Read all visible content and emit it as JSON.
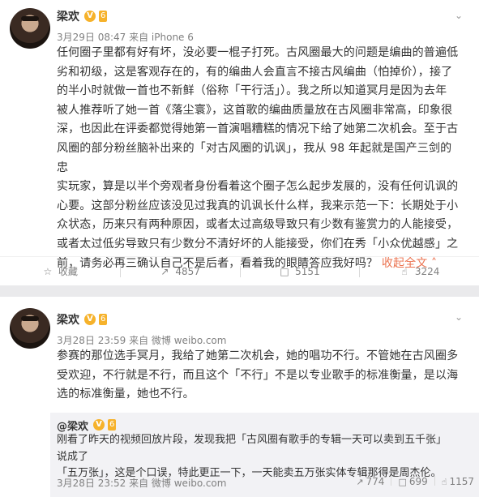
{
  "post1": {
    "author": "梁欢",
    "v_badge": "V",
    "level_badge": "6",
    "meta": "3月29日 08:47 来自 iPhone 6",
    "text_lines": [
      "任何圈子里都有好有坏，没必要一棍子打死。古风圈最大的问题是编曲的普遍低",
      "劣和初级，这是客观存在的，有的编曲人会直言不接古风编曲（怕掉价），接了",
      "的半小时就做一首也不新鲜（俗称「干行活」）。我之所以知道冥月是因为去年",
      "被人推荐听了她一首《落尘寰》，这首歌的编曲质量放在古风圈非常高，印象很",
      "深，也因此在评委都觉得她第一首演唱糟糕的情况下给了她第二次机会。至于古",
      "风圈的部分粉丝脑补出来的「对古风圈的讥讽」，我从 98 年起就是国产三剑的忠",
      "实玩家，算是以半个旁观者身份看着这个圈子怎么起步发展的，没有任何讥讽的",
      "心要。这部分粉丝应该没见过我真的讥讽长什么样，我来示范一下：长期处于小",
      "众状态，历来只有两种原因，或者太过高级导致只有少数有鉴赏力的人能接受，",
      "或者太过低劣导致只有少数分不清好坏的人能接受，你们在秀「小众优越感」之",
      "前，请务必再三确认自己不是后者，看着我的眼睛答应我好吗？"
    ],
    "collapse_label": "收起全文",
    "actions": {
      "favorite": "收藏",
      "repost": "4857",
      "comment": "5151",
      "like": "3224"
    }
  },
  "post2": {
    "author": "梁欢",
    "v_badge": "V",
    "level_badge": "6",
    "meta": "3月28日 23:59 来自 微博 weibo.com",
    "text_lines": [
      "参赛的那位选手冥月，我给了她第二次机会，她的唱功不行。不管她在古风圈多",
      "受欢迎，不行就是不行，而且这个「不行」不是以专业歌手的标准衡量，是以海",
      "选的标准衡量，她也不行。"
    ],
    "repost": {
      "author": "@梁欢",
      "v_badge": "V",
      "level_badge": "6",
      "text_lines": [
        "刚看了昨天的视频回放片段，发现我把「古风圈有歌手的专辑一天可以卖到五千张」说成了",
        "「五万张」，这是个口误，特此更正一下，一天能卖五万张实体专辑那得是周杰伦。"
      ],
      "meta": "3月28日 23:52 来自 微博 weibo.com",
      "stats": {
        "repost": "774",
        "comment": "699",
        "like": "1157"
      }
    }
  },
  "colors": {
    "accent": "#eb7350",
    "badge": "#f6b22b",
    "text": "#333333",
    "meta": "#808080",
    "page_bg": "#eaeaec"
  }
}
